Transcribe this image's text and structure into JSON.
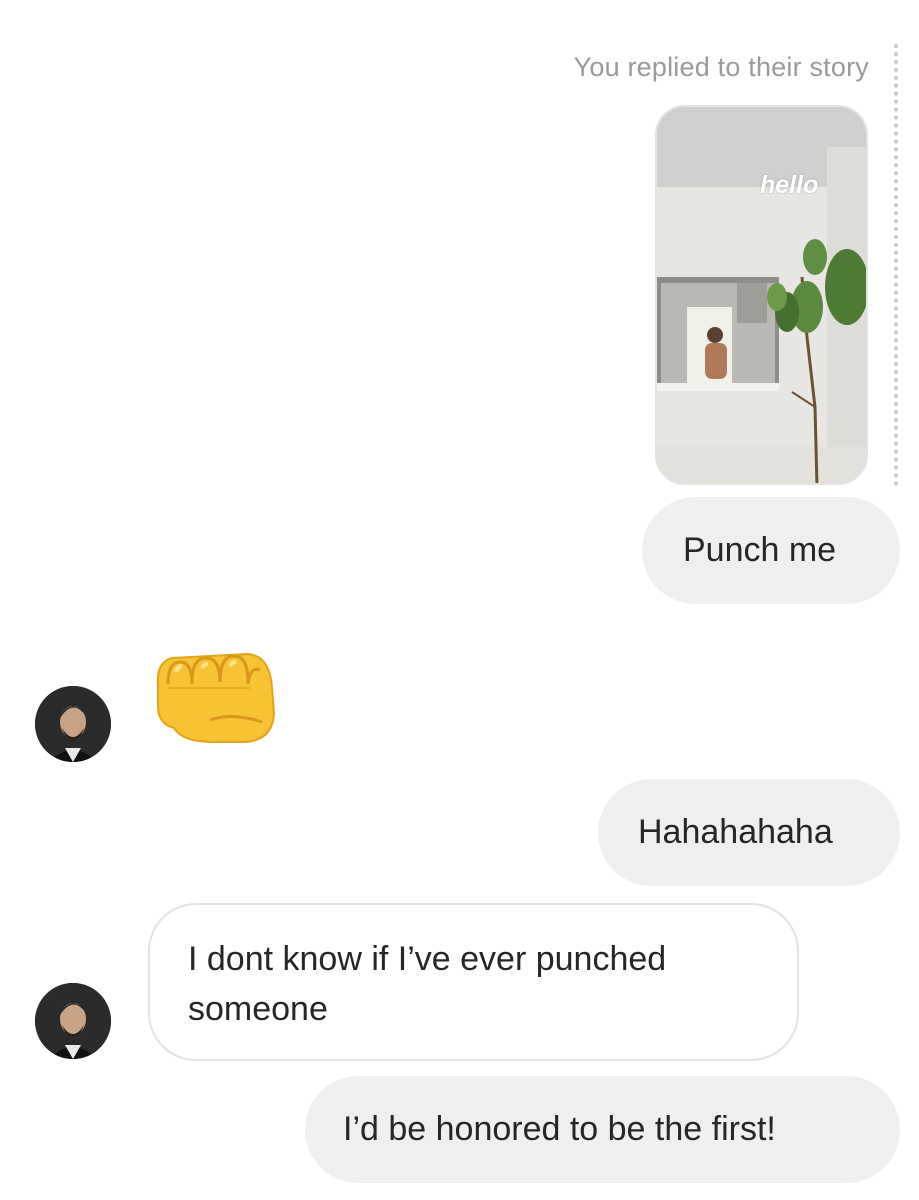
{
  "story_reply": {
    "caption": "You replied to their story",
    "sticker_text": "hello"
  },
  "messages": [
    {
      "sender": "me",
      "text": "Punch me"
    },
    {
      "sender": "them",
      "type": "emoji",
      "emoji_name": "oncoming-fist"
    },
    {
      "sender": "me",
      "text": "Hahahahaha"
    },
    {
      "sender": "them",
      "text": "I dont know if I’ve ever punched someone"
    },
    {
      "sender": "me",
      "text": "I’d be honored to be the first!"
    }
  ],
  "colors": {
    "outgoing_bubble": "#efefef",
    "incoming_border": "#e3e3e3",
    "caption_gray": "#9a9a9a",
    "text": "#262626"
  },
  "icons": [
    "oncoming-fist-emoji",
    "avatar"
  ]
}
